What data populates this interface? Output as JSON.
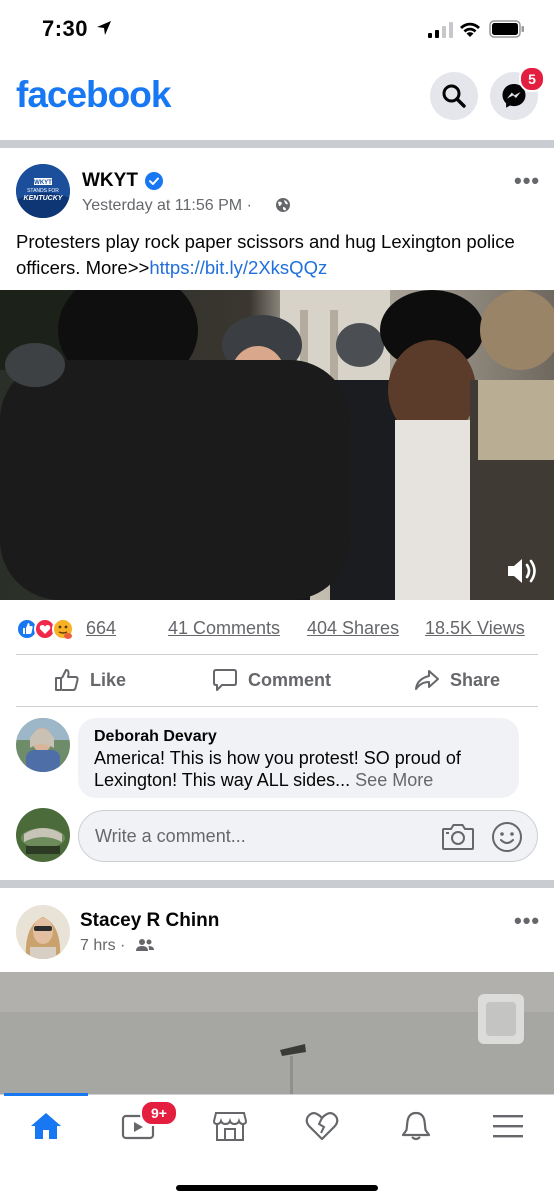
{
  "status_bar": {
    "time": "7:30"
  },
  "header": {
    "logo": "facebook",
    "messenger_badge": "5"
  },
  "post1": {
    "avatar_text_top": "WKYT",
    "avatar_text_mid": "STANDS FOR",
    "avatar_text_bottom": "KENTUCKY",
    "page_name": "WKYT",
    "timestamp": "Yesterday at 11:56 PM",
    "dot": "·",
    "text": "Protesters play rock paper scissors and hug Lexington police officers. More>>",
    "link": "https://bit.ly/2XksQQz",
    "reactions_count": "664",
    "comments": "41 Comments",
    "shares": "404 Shares",
    "views": "18.5K Views",
    "actions": {
      "like": "Like",
      "comment": "Comment",
      "share": "Share"
    },
    "top_comment": {
      "author": "Deborah Devary",
      "text": "America! This is how you protest! SO proud of Lexington! This way ALL sides...",
      "see_more": "See More"
    },
    "write_comment_placeholder": "Write a comment..."
  },
  "post2": {
    "author": "Stacey R Chinn",
    "timestamp": "7 hrs",
    "dot": "·"
  },
  "bottom_nav": {
    "watch_badge": "9+"
  },
  "colors": {
    "brand": "#1877f2",
    "badge": "#e41e3f",
    "link": "#216fdb"
  }
}
